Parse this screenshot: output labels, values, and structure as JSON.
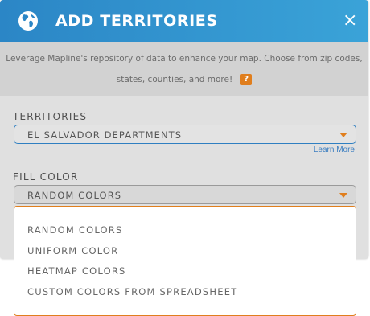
{
  "header": {
    "title": "ADD TERRITORIES",
    "close_label": "×",
    "icon": "globe-icon",
    "gradient_start": "#2b86c6",
    "gradient_end": "#3aa3d8"
  },
  "info": {
    "line1": "Leverage Mapline's repository of data to enhance your map. Choose from zip codes,",
    "line2": "states, counties, and more!",
    "help_label": "?"
  },
  "territories": {
    "label": "TERRITORIES",
    "selected": "EL SALVADOR DEPARTMENTS",
    "learn_more": "Learn More"
  },
  "fill_color": {
    "label": "FILL COLOR",
    "selected": "RANDOM COLORS",
    "options": [
      "RANDOM COLORS",
      "UNIFORM COLOR",
      "HEATMAP COLORS",
      "CUSTOM COLORS FROM SPREADSHEET"
    ]
  },
  "colors": {
    "accent": "#e07e1d",
    "link": "#3a7dc0",
    "active_border": "#2f7fc1"
  }
}
